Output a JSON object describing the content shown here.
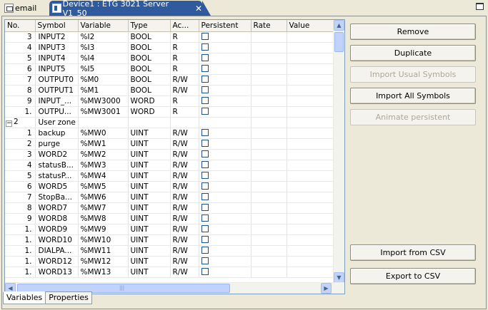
{
  "tabs": {
    "email_label": "email",
    "device_label": "Device1 : ETG 3021 Server V1_50",
    "close_glyph": "✕"
  },
  "table": {
    "columns": [
      "No.",
      "Symbol",
      "Variable",
      "Type",
      "Ac...",
      "Persistent",
      "Rate",
      "Value"
    ],
    "rows": [
      {
        "no": "3",
        "symbol": "INPUT2",
        "variable": "%I2",
        "type": "BOOL",
        "access": "R",
        "persistent": true
      },
      {
        "no": "4",
        "symbol": "INPUT3",
        "variable": "%I3",
        "type": "BOOL",
        "access": "R",
        "persistent": true
      },
      {
        "no": "5",
        "symbol": "INPUT4",
        "variable": "%I4",
        "type": "BOOL",
        "access": "R",
        "persistent": true
      },
      {
        "no": "6",
        "symbol": "INPUT5",
        "variable": "%I5",
        "type": "BOOL",
        "access": "R",
        "persistent": true
      },
      {
        "no": "7",
        "symbol": "OUTPUT0",
        "variable": "%M0",
        "type": "BOOL",
        "access": "R/W",
        "persistent": true
      },
      {
        "no": "8",
        "symbol": "OUTPUT1",
        "variable": "%M1",
        "type": "BOOL",
        "access": "R/W",
        "persistent": true
      },
      {
        "no": "9",
        "symbol": "INPUT_...",
        "variable": "%MW3000",
        "type": "WORD",
        "access": "R",
        "persistent": true
      },
      {
        "no": "1.",
        "symbol": "OUTPU...",
        "variable": "%MW3001",
        "type": "WORD",
        "access": "R",
        "persistent": true
      },
      {
        "group": true,
        "no": "2",
        "symbol": "User zone",
        "expander": "−"
      },
      {
        "no": "1",
        "symbol": "backup",
        "variable": "%MW0",
        "type": "UINT",
        "access": "R/W",
        "persistent": true
      },
      {
        "no": "2",
        "symbol": "purge",
        "variable": "%MW1",
        "type": "UINT",
        "access": "R/W",
        "persistent": true
      },
      {
        "no": "3",
        "symbol": "WORD2",
        "variable": "%MW2",
        "type": "UINT",
        "access": "R/W",
        "persistent": true
      },
      {
        "no": "4",
        "symbol": "statusB...",
        "variable": "%MW3",
        "type": "UINT",
        "access": "R/W",
        "persistent": true
      },
      {
        "no": "5",
        "symbol": "statusP...",
        "variable": "%MW4",
        "type": "UINT",
        "access": "R/W",
        "persistent": true
      },
      {
        "no": "6",
        "symbol": "WORD5",
        "variable": "%MW5",
        "type": "UINT",
        "access": "R/W",
        "persistent": true
      },
      {
        "no": "7",
        "symbol": "StopBa...",
        "variable": "%MW6",
        "type": "UINT",
        "access": "R/W",
        "persistent": true
      },
      {
        "no": "8",
        "symbol": "WORD7",
        "variable": "%MW7",
        "type": "UINT",
        "access": "R/W",
        "persistent": true
      },
      {
        "no": "9",
        "symbol": "WORD8",
        "variable": "%MW8",
        "type": "UINT",
        "access": "R/W",
        "persistent": true
      },
      {
        "no": "1.",
        "symbol": "WORD9",
        "variable": "%MW9",
        "type": "UINT",
        "access": "R/W",
        "persistent": true
      },
      {
        "no": "1.",
        "symbol": "WORD10",
        "variable": "%MW10",
        "type": "UINT",
        "access": "R/W",
        "persistent": true
      },
      {
        "no": "1.",
        "symbol": "DIALPA...",
        "variable": "%MW11",
        "type": "UINT",
        "access": "R/W",
        "persistent": true
      },
      {
        "no": "1.",
        "symbol": "WORD12",
        "variable": "%MW12",
        "type": "UINT",
        "access": "R/W",
        "persistent": true
      },
      {
        "no": "1.",
        "symbol": "WORD13",
        "variable": "%MW13",
        "type": "UINT",
        "access": "R/W",
        "persistent": true
      }
    ]
  },
  "scroll": {
    "up_glyph": "▲",
    "down_glyph": "▼",
    "left_glyph": "◀",
    "right_glyph": "▶",
    "grip_glyph": "|||"
  },
  "buttons": {
    "remove": "Remove",
    "duplicate": "Duplicate",
    "import_usual": "Import Usual Symbols",
    "import_all": "Import All Symbols",
    "animate_persistent": "Animate persistent",
    "import_csv": "Import from CSV",
    "export_csv": "Export to CSV"
  },
  "view_tabs": {
    "variables": "Variables",
    "properties": "Properties"
  }
}
